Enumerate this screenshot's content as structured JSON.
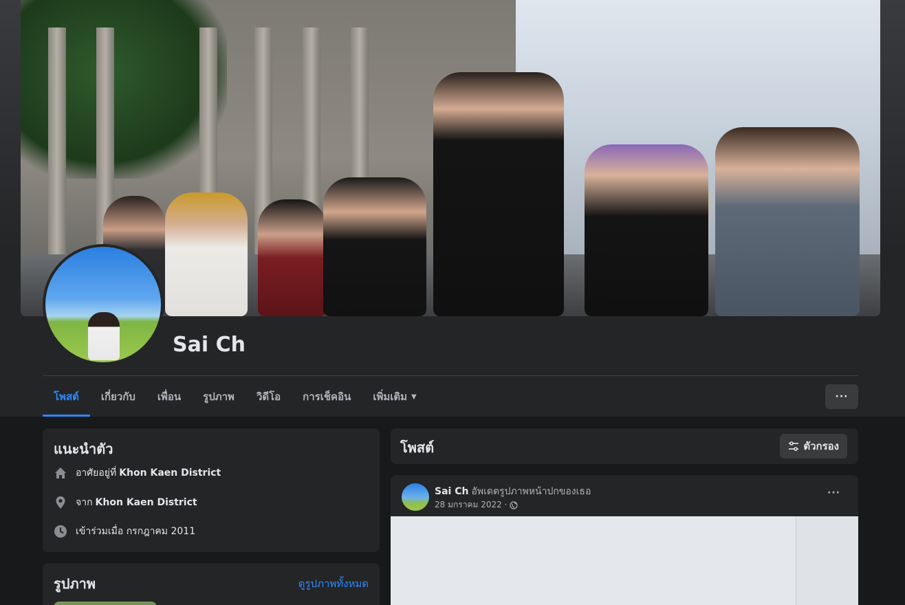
{
  "profile": {
    "name": "Sai Ch"
  },
  "tabs": [
    {
      "label": "โพสต์",
      "active": true
    },
    {
      "label": "เกี่ยวกับ"
    },
    {
      "label": "เพื่อน"
    },
    {
      "label": "รูปภาพ"
    },
    {
      "label": "วิดีโอ"
    },
    {
      "label": "การเช็คอิน"
    },
    {
      "label": "เพิ่มเติม",
      "has_dropdown": true
    }
  ],
  "more_button_label": "···",
  "intro": {
    "title": "แนะนำตัว",
    "rows": [
      {
        "icon": "home-icon",
        "text": "อาศัยอยู่ที่",
        "bold": "Khon Kaen District"
      },
      {
        "icon": "location-pin-icon",
        "text": "จาก",
        "bold": "Khon Kaen District"
      },
      {
        "icon": "clock-icon",
        "text": "เข้าร่วมเมื่อ กรกฎาคม 2011",
        "bold": ""
      }
    ]
  },
  "photos": {
    "title": "รูปภาพ",
    "see_all": "ดูรูปภาพทั้งหมด"
  },
  "posts": {
    "title": "โพสต์",
    "filter_label": "ตัวกรอง"
  },
  "post": {
    "author": "Sai Ch",
    "action": "อัพเดตรูปภาพหน้าปกของเธอ",
    "date": "28 มกราคม 2022 ·",
    "menu": "···"
  },
  "colors": {
    "background": "#18191a",
    "card": "#242526",
    "accent": "#2d88ff",
    "button": "#3a3b3c",
    "text_primary": "#e4e6eb",
    "text_secondary": "#b0b3b8"
  }
}
